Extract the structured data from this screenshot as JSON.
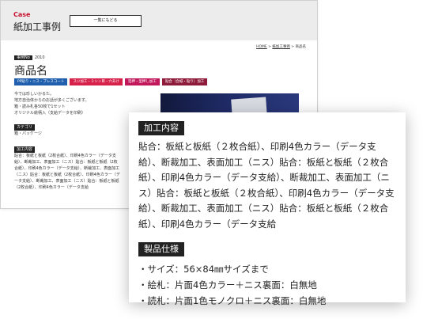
{
  "background_page": {
    "header": {
      "case_label": "Case",
      "title": "紙加工事例",
      "back_button": "一覧にもどる"
    },
    "breadcrumb": {
      "home": "HOME",
      "sep1": " > ",
      "parent": "紙加工事例",
      "sep2": " > ",
      "current": "商品名"
    },
    "case_no": {
      "label": "事例No",
      "value": "2010"
    },
    "product_name": "商品名",
    "tags": [
      {
        "label": "PP貼り・ニス・プレスコート",
        "color": "#1f5fae"
      },
      {
        "label": "スジ加工・ミシン目・穴あけ",
        "color": "#d6214b"
      },
      {
        "label": "箔押・型押し加工",
        "color": "#c2185b"
      },
      {
        "label": "貼合（合紙・貼り）加工",
        "color": "#8e1b3a"
      }
    ],
    "description": [
      "今では珍しいかるた。",
      "地方自治体からのお話が多くございます。",
      "箱・読み札各50枚で1セット",
      "オリジナル絵柄入（支給データを印刷）"
    ],
    "category": {
      "label": "カテゴリ",
      "value": "箱・パッケージ"
    },
    "processing": {
      "label": "加工内容",
      "lines": [
        "貼合：板紙と板紙（2枚合紙）、印刷4色カラー（データ支",
        "給）、断裁加工、表面加工（ニス）貼合：板紙と板紙（2枚",
        "合紙）、印刷4色カラー（データ支給）、断裁加工、表面加工",
        "（ニス）貼合：板紙と板紙（2枚合紙）、印刷4色カラー（デ",
        "ータ支給）、断裁加工、表面加工（ニス）貼合：板紙と板紙",
        "（2枚合紙）、印刷4色カラー（データ支給"
      ]
    }
  },
  "card": {
    "processing_label": "加工内容",
    "processing_text": "貼合：板紙と板紙（２枚合紙）、印刷4色カラー（データ支給）、断裁加工、表面加工（ニス）貼合：板紙と板紙（２枚合紙）、印刷4色カラー（データ支給）、断裁加工、表面加工（ニス）貼合：板紙と板紙（２枚合紙）、印刷4色カラー（データ支給）、断裁加工、表面加工（ニス）貼合：板紙と板紙（２枚合紙）、印刷4色カラー（データ支給",
    "spec_label": "製品仕様",
    "specs": [
      "・サイズ：56×84㎜サイズまで",
      "・絵札：片面4色カラー＋ニス裏面：白無地",
      "・読札：片面1色モノクロ＋ニス裏面：白無地"
    ]
  }
}
